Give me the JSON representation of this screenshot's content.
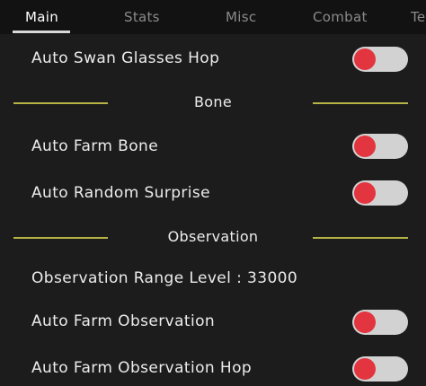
{
  "tabs": [
    {
      "label": "Main",
      "active": true
    },
    {
      "label": "Stats",
      "active": false
    },
    {
      "label": "Misc",
      "active": false
    },
    {
      "label": "Combat",
      "active": false
    },
    {
      "label": "Te",
      "active": false
    }
  ],
  "rows": {
    "swan_glasses_hop": {
      "label": "Auto Swan Glasses Hop",
      "enabled": false
    },
    "farm_bone": {
      "label": "Auto Farm Bone",
      "enabled": false
    },
    "random_surprise": {
      "label": "Auto Random Surprise",
      "enabled": false
    },
    "farm_observation": {
      "label": "Auto Farm Observation",
      "enabled": false
    },
    "farm_observation_hop": {
      "label": "Auto Farm Observation Hop",
      "enabled": false
    }
  },
  "sections": {
    "bone": "Bone",
    "observation": "Observation"
  },
  "observation_range_text": "Observation Range Level : 33000",
  "colors": {
    "background": "#1c1c1c",
    "tabbar": "#121212",
    "toggle_track": "#d2d2d2",
    "toggle_knob_off": "#e2353f",
    "section_line": "#b7b446",
    "text": "#ececec"
  }
}
